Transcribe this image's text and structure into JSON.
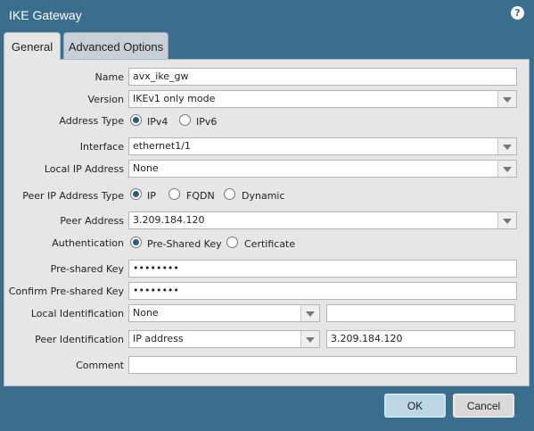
{
  "window": {
    "title": "IKE Gateway",
    "help_icon": "?"
  },
  "tabs": [
    {
      "label": "General",
      "active": true
    },
    {
      "label": "Advanced Options",
      "active": false
    }
  ],
  "form": {
    "name": {
      "label": "Name",
      "value": "avx_ike_gw"
    },
    "version": {
      "label": "Version",
      "value": "IKEv1 only mode"
    },
    "address_type": {
      "label": "Address Type",
      "options": [
        "IPv4",
        "IPv6"
      ],
      "selected": "IPv4"
    },
    "interface": {
      "label": "Interface",
      "value": "ethernet1/1"
    },
    "local_ip": {
      "label": "Local IP Address",
      "value": "None"
    },
    "peer_ip_type": {
      "label": "Peer IP Address Type",
      "options": [
        "IP",
        "FQDN",
        "Dynamic"
      ],
      "selected": "IP"
    },
    "peer_address": {
      "label": "Peer Address",
      "value": "3.209.184.120"
    },
    "authentication": {
      "label": "Authentication",
      "options": [
        "Pre-Shared Key",
        "Certificate"
      ],
      "selected": "Pre-Shared Key"
    },
    "psk": {
      "label": "Pre-shared Key",
      "value": "••••••••"
    },
    "confirm_psk": {
      "label": "Confirm Pre-shared Key",
      "value": "••••••••"
    },
    "local_id": {
      "label": "Local Identification",
      "type": "None",
      "value": ""
    },
    "peer_id": {
      "label": "Peer Identification",
      "type": "IP address",
      "value": "3.209.184.120"
    },
    "comment": {
      "label": "Comment",
      "value": ""
    }
  },
  "buttons": {
    "ok": "OK",
    "cancel": "Cancel"
  }
}
